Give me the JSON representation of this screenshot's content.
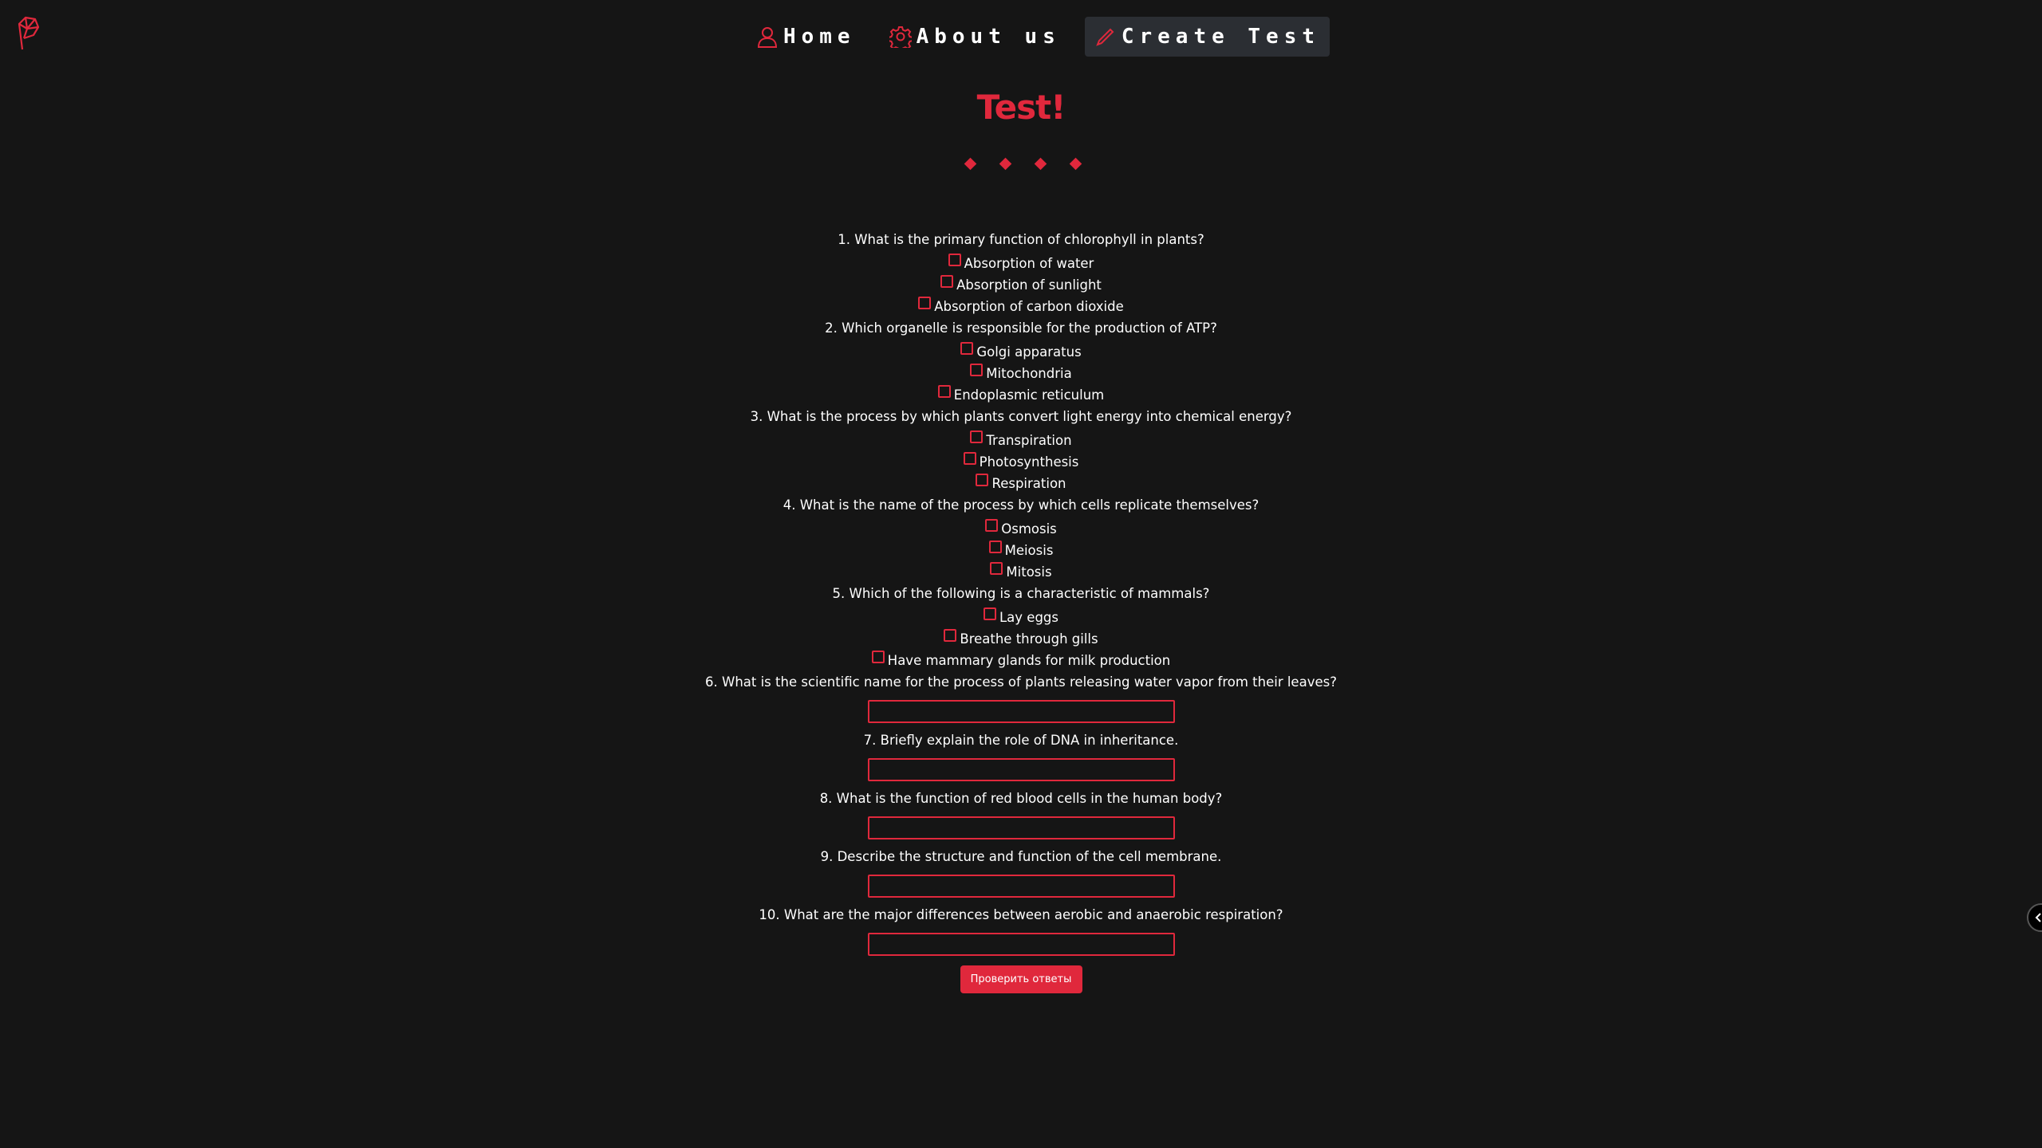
{
  "nav": {
    "items": [
      {
        "label": "Home",
        "icon": "user-icon"
      },
      {
        "label": "About us",
        "icon": "gear-icon"
      },
      {
        "label": "Create Test",
        "icon": "pen-icon",
        "active": true
      }
    ]
  },
  "title": "Test!",
  "colors": {
    "accent": "#e0283c",
    "background": "#151515",
    "active_nav": "#2b2e33"
  },
  "quiz": {
    "questions": [
      {
        "text": "1. What is the primary function of chlorophyll in plants?",
        "options": [
          "Absorption of water",
          "Absorption of sunlight",
          "Absorption of carbon dioxide"
        ]
      },
      {
        "text": "2. Which organelle is responsible for the production of ATP?",
        "options": [
          "Golgi apparatus",
          "Mitochondria",
          "Endoplasmic reticulum"
        ]
      },
      {
        "text": "3. What is the process by which plants convert light energy into chemical energy?",
        "options": [
          "Transpiration",
          "Photosynthesis",
          "Respiration"
        ]
      },
      {
        "text": "4. What is the name of the process by which cells replicate themselves?",
        "options": [
          "Osmosis",
          "Meiosis",
          "Mitosis"
        ]
      },
      {
        "text": "5. Which of the following is a characteristic of mammals?",
        "options": [
          "Lay eggs",
          "Breathe through gills",
          "Have mammary glands for milk production"
        ]
      },
      {
        "text": "6. What is the scientific name for the process of plants releasing water vapor from their leaves?",
        "answer": ""
      },
      {
        "text": "7. Briefly explain the role of DNA in inheritance.",
        "answer": ""
      },
      {
        "text": "8. What is the function of red blood cells in the human body?",
        "answer": ""
      },
      {
        "text": "9. Describe the structure and function of the cell membrane.",
        "answer": ""
      },
      {
        "text": "10. What are the major differences between aerobic and anaerobic respiration?",
        "answer": ""
      }
    ],
    "submit_label": "Проверить ответы"
  }
}
